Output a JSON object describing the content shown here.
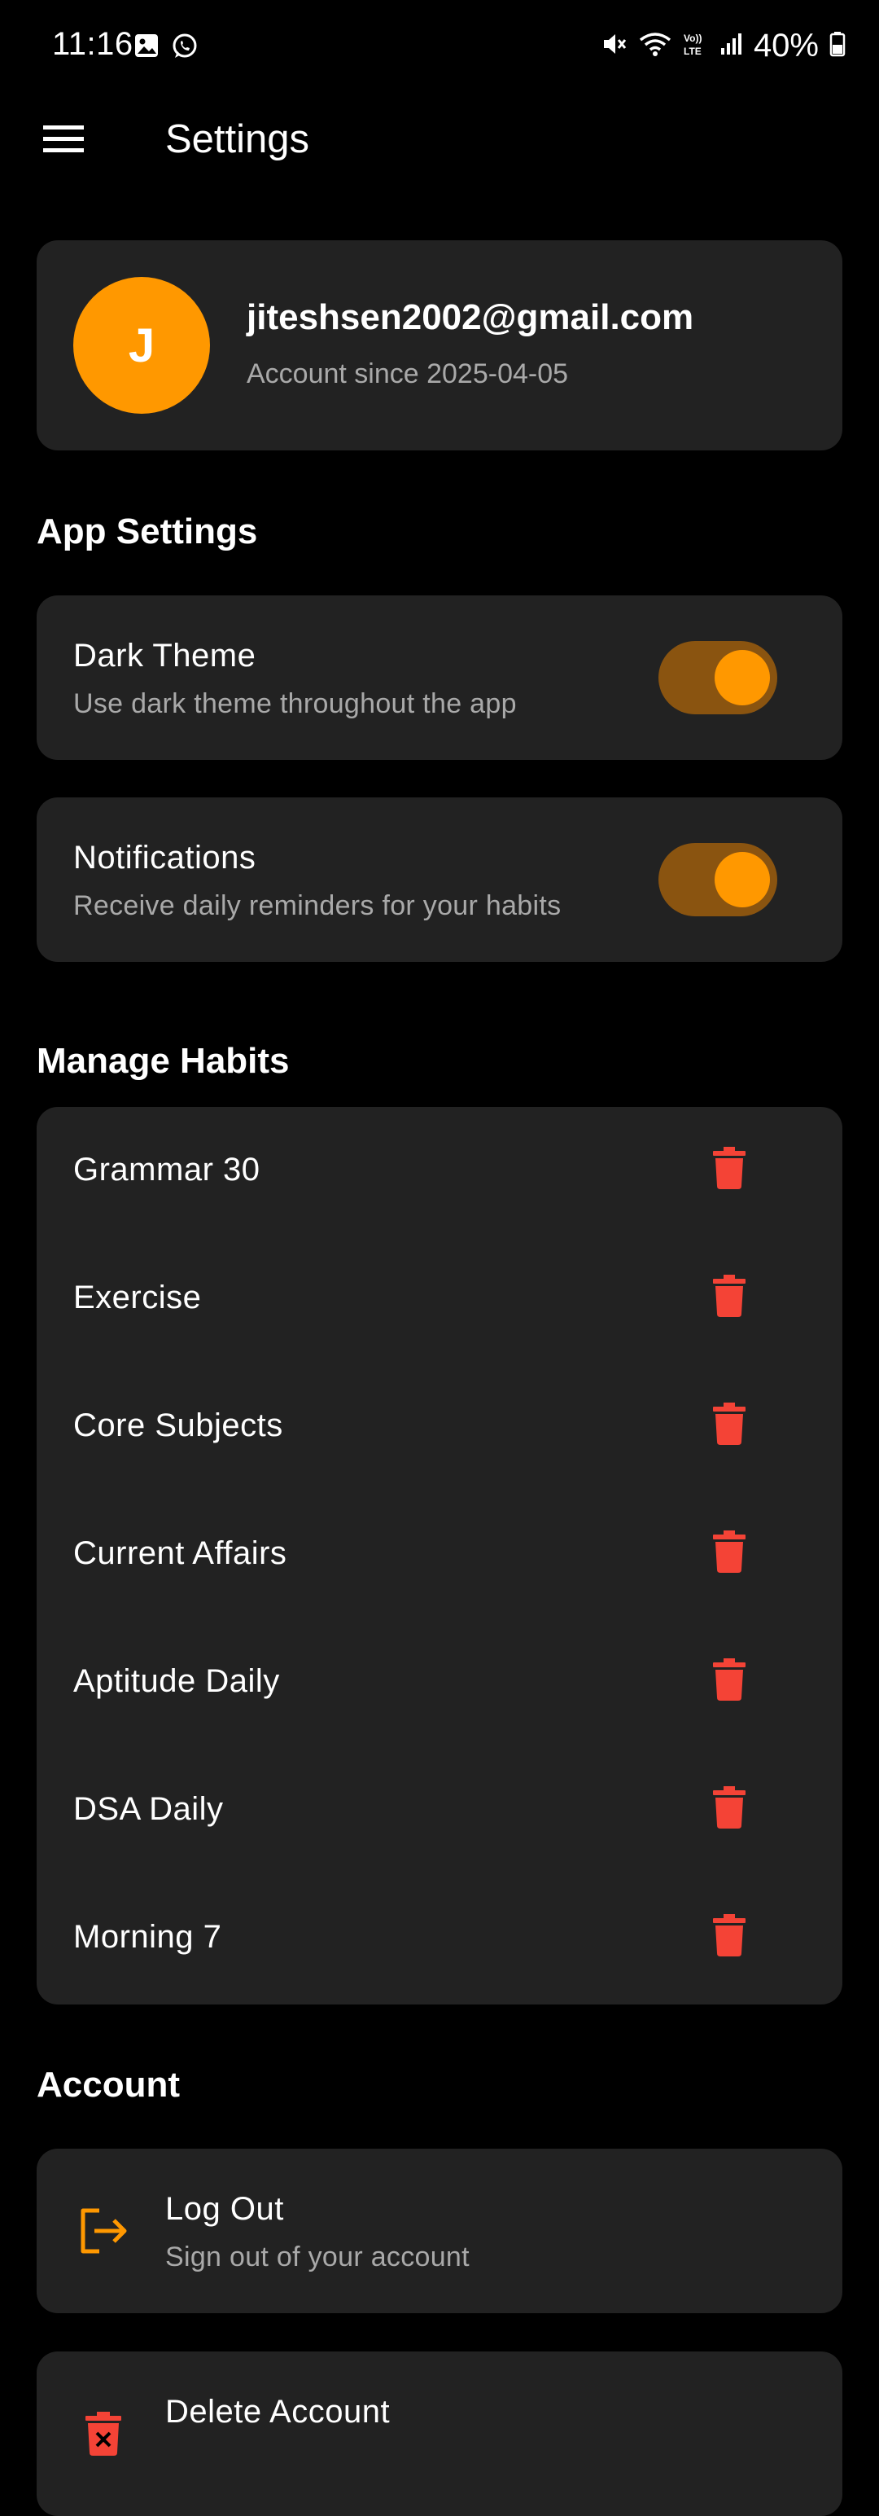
{
  "status_bar": {
    "time": "11:16",
    "battery": "40%",
    "left_icons": [
      "gallery-icon",
      "whatsapp-icon"
    ],
    "right_icons": [
      "mute-icon",
      "wifi-icon",
      "volte-icon",
      "signal-icon",
      "battery-icon"
    ]
  },
  "app_bar": {
    "title": "Settings",
    "menu_icon": "hamburger-menu-icon"
  },
  "profile": {
    "avatar_letter": "J",
    "email": "jiteshsen2002@gmail.com",
    "since": "Account since 2025-04-05"
  },
  "app_settings": {
    "heading": "App Settings",
    "items": [
      {
        "title": "Dark Theme",
        "subtitle": "Use dark theme throughout the app",
        "enabled": true
      },
      {
        "title": "Notifications",
        "subtitle": "Receive daily reminders for your habits",
        "enabled": true
      }
    ]
  },
  "manage_habits": {
    "heading": "Manage Habits",
    "delete_icon": "trash-icon",
    "habits": [
      "Grammar 30",
      "Exercise",
      "Core Subjects",
      "Current Affairs",
      "Aptitude Daily",
      "DSA Daily",
      "Morning 7"
    ]
  },
  "account": {
    "heading": "Account",
    "items": [
      {
        "title": "Log Out",
        "subtitle": "Sign out of your account",
        "icon": "logout-icon"
      },
      {
        "title": "Delete Account",
        "subtitle": "",
        "icon": "delete-account-icon"
      }
    ]
  },
  "colors": {
    "accent": "#FF9800",
    "toggle_track": "#8A5410",
    "danger": "#F44336",
    "card": "#222222",
    "background": "#000000",
    "secondary_text": "#A9A9A9"
  }
}
